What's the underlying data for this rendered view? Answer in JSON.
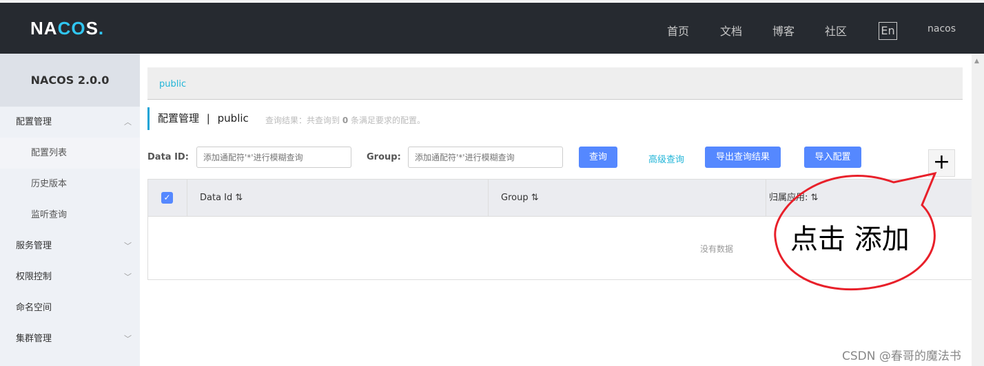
{
  "header": {
    "logo": "NACOS.",
    "nav": [
      "首页",
      "文档",
      "博客",
      "社区"
    ],
    "lang": "En",
    "user": "nacos"
  },
  "sidebar": {
    "title": "NACOS 2.0.0",
    "items": [
      {
        "label": "配置管理",
        "expanded": true
      },
      {
        "label": "配置列表",
        "sub": true,
        "active": true
      },
      {
        "label": "历史版本",
        "sub": true
      },
      {
        "label": "监听查询",
        "sub": true
      },
      {
        "label": "服务管理"
      },
      {
        "label": "权限控制"
      },
      {
        "label": "命名空间"
      },
      {
        "label": "集群管理"
      }
    ]
  },
  "breadcrumb": "public",
  "page": {
    "title": "配置管理",
    "sep": "|",
    "namespace": "public",
    "result_prefix": "查询结果：共查询到",
    "result_count": "0",
    "result_suffix": "条满足要求的配置。"
  },
  "search": {
    "dataid_label": "Data ID:",
    "dataid_placeholder": "添加通配符'*'进行模糊查询",
    "group_label": "Group:",
    "group_placeholder": "添加通配符'*'进行模糊查询",
    "query": "查询",
    "advanced": "高级查询",
    "export": "导出查询结果",
    "import": "导入配置",
    "add": "+"
  },
  "table": {
    "columns": [
      "Data Id",
      "Group",
      "归属应用:"
    ],
    "sort_icon": "⇅",
    "empty": "没有数据",
    "checked": true
  },
  "annotation": {
    "text": "点击 添加",
    "color": "#e8202a"
  },
  "watermark": "CSDN @春哥的魔法书",
  "colors": {
    "topbar": "#262a30",
    "primary": "#5588ff",
    "accent": "#22b5d8"
  }
}
